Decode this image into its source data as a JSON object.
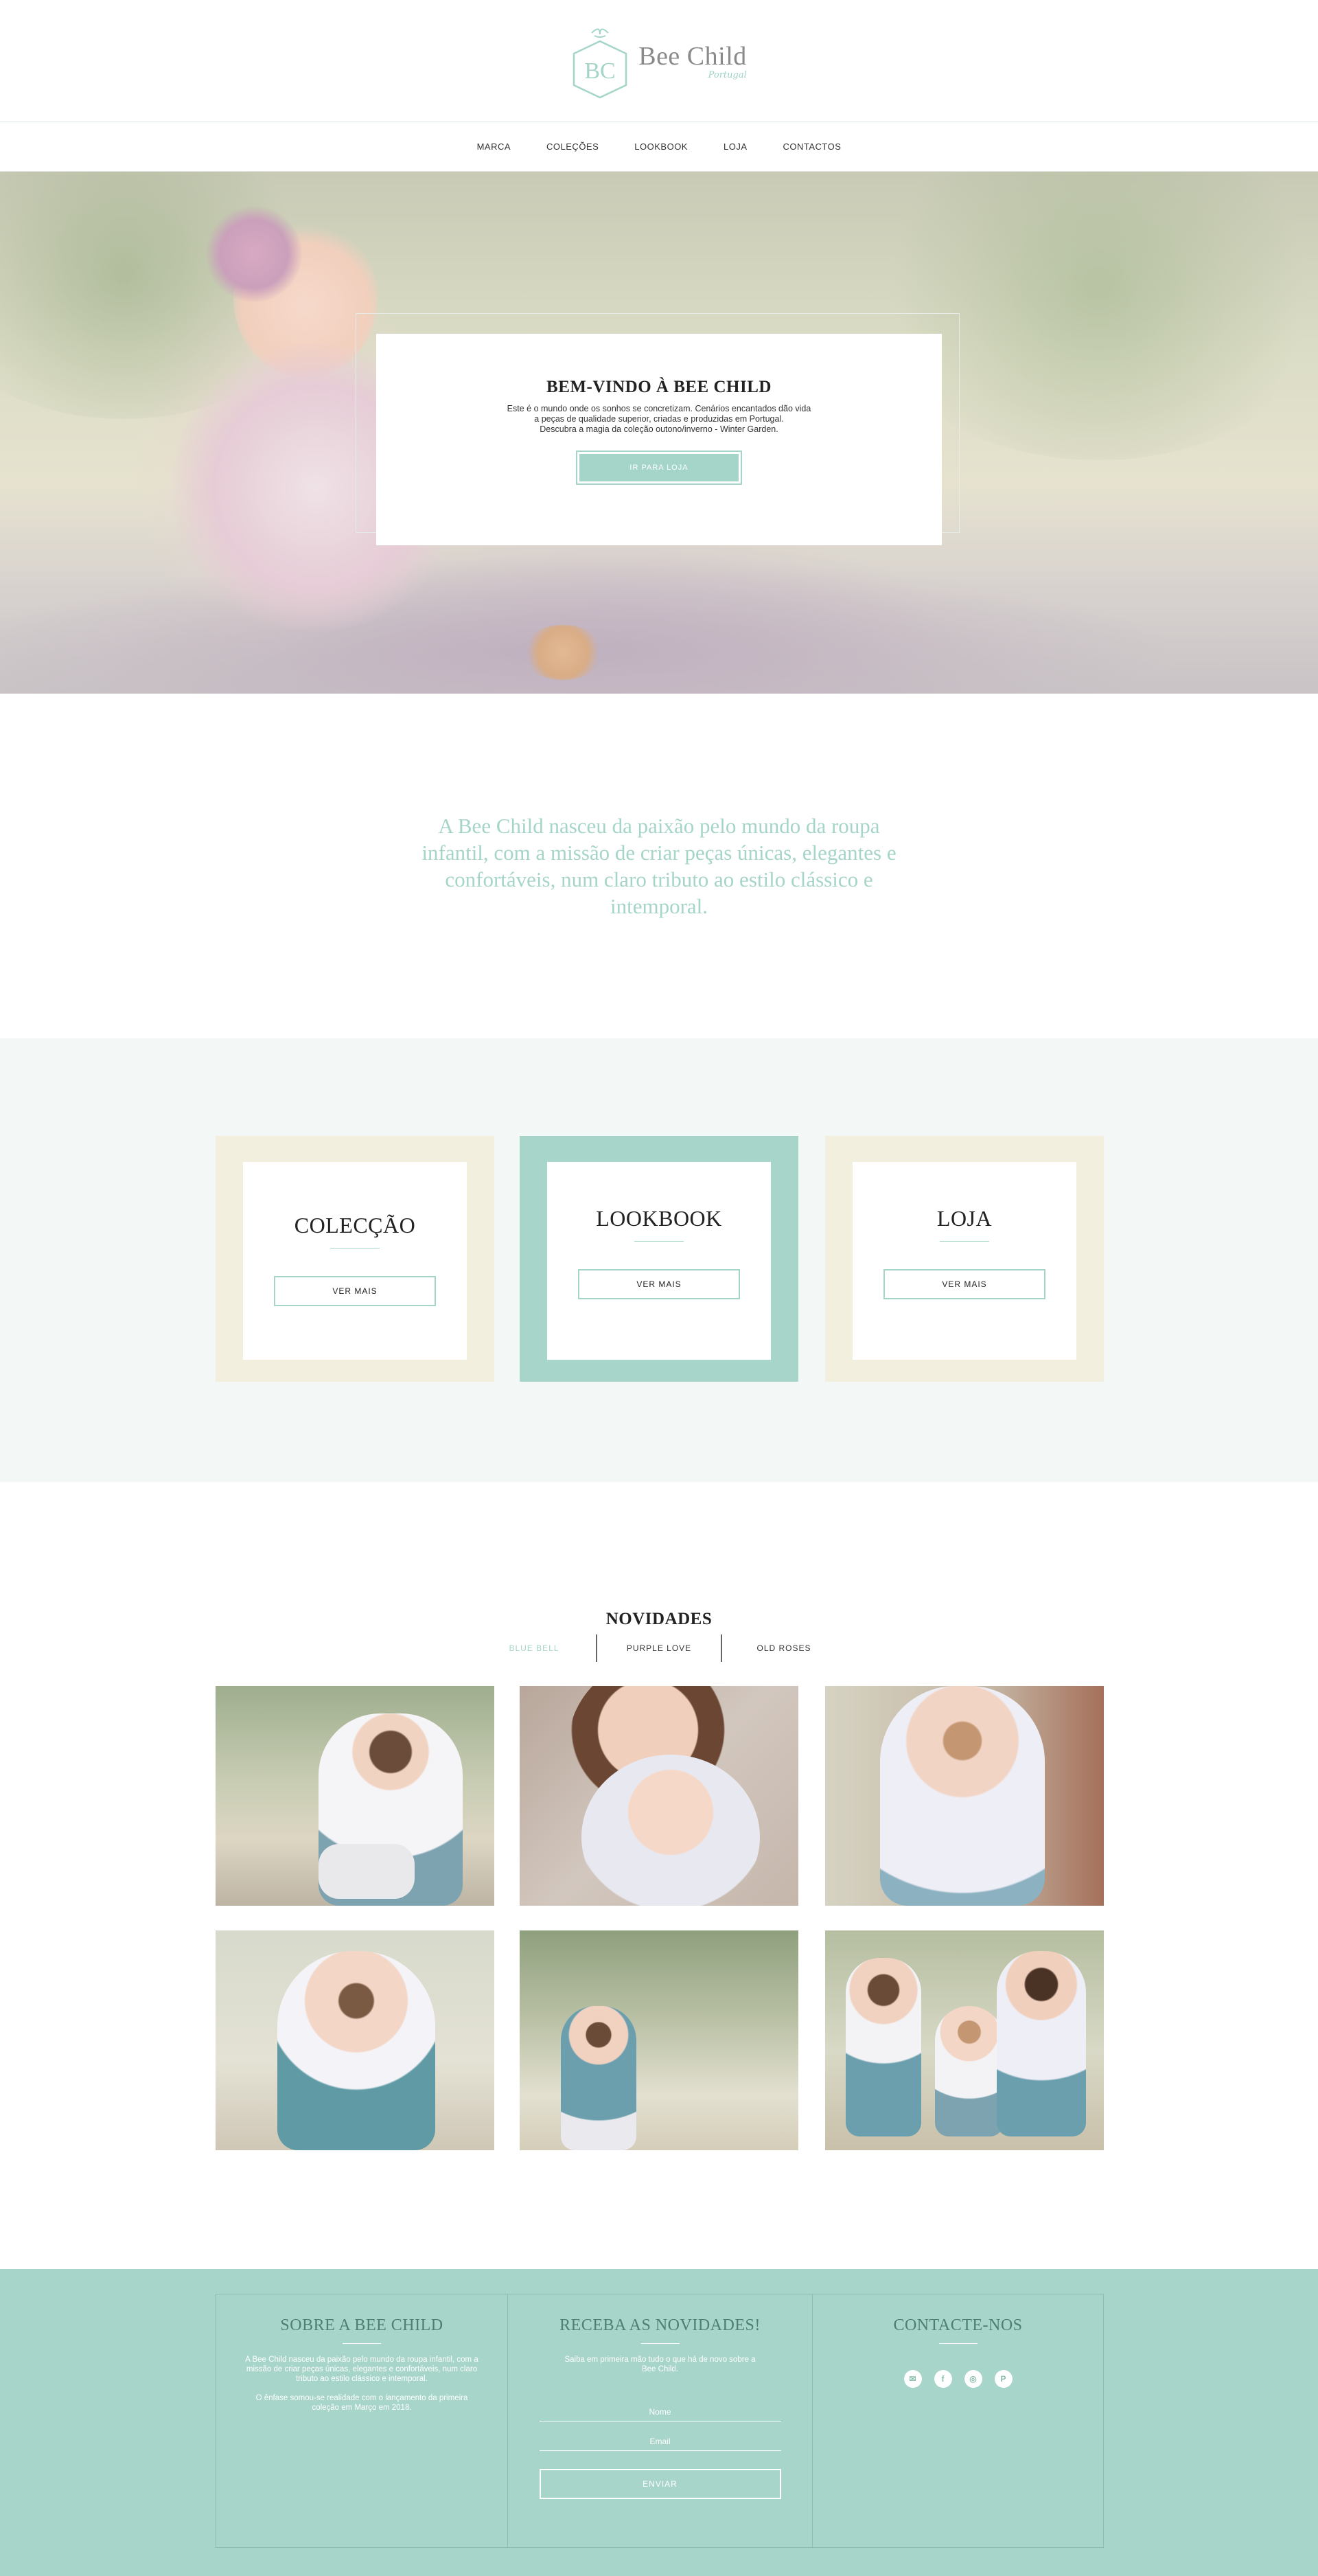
{
  "brand": {
    "initials": "BC",
    "name": "Bee Child",
    "sub": "Portugal",
    "accent": "#a5d5c9"
  },
  "nav": {
    "items": [
      "MARCA",
      "COLEÇÕES",
      "LOOKBOOK",
      "LOJA",
      "CONTACTOS"
    ]
  },
  "hero": {
    "title": "BEM-VINDO À BEE CHILD",
    "line1": "Este é o mundo onde os sonhos se concretizam. Cenários encantados dão vida",
    "line2": "a peças de qualidade superior, criadas e produzidas em Portugal.",
    "line3": "Descubra a magia da coleção outono/inverno - Winter Garden.",
    "button": "IR PARA LOJA"
  },
  "intro": {
    "text": "A Bee Child nasceu da paixão pelo mundo da roupa infantil, com a missão de criar peças únicas, elegantes e confortáveis, num claro tributo ao estilo clássico e intemporal."
  },
  "categories": [
    {
      "title": "COLECÇÃO",
      "button": "VER MAIS",
      "frame_color": "#f3efdf"
    },
    {
      "title": "LOOKBOOK",
      "button": "VER MAIS",
      "frame_color": "#a8d5c9"
    },
    {
      "title": "LOJA",
      "button": "VER MAIS",
      "frame_color": "#f3efdf"
    }
  ],
  "news": {
    "title": "NOVIDADES",
    "tabs": [
      "BLUE BELL",
      "PURPLE LOVE",
      "OLD ROSES"
    ],
    "active_tab": "BLUE BELL"
  },
  "footer": {
    "about": {
      "title": "SOBRE A BEE CHILD",
      "text1": "A Bee Child nasceu da paixão pelo mundo da roupa infantil, com a missão de criar peças únicas, elegantes e confortáveis, num claro tributo ao estilo clássico e intemporal.",
      "text2": "O ênfase somou-se realidade com o lançamento da primeira coleção em Março em 2018."
    },
    "newsletter": {
      "title": "RECEBA AS NOVIDADES!",
      "text": "Saiba em primeira mão tudo o que há de novo sobre a Bee Child.",
      "name_placeholder": "Nome",
      "email_placeholder": "Email",
      "button": "ENVIAR"
    },
    "contact": {
      "title": "CONTACTE-NOS",
      "icons": [
        "email-icon",
        "facebook-icon",
        "instagram-icon",
        "pinterest-icon"
      ],
      "icon_glyphs": [
        "✉",
        "f",
        "◎",
        "P"
      ]
    }
  }
}
